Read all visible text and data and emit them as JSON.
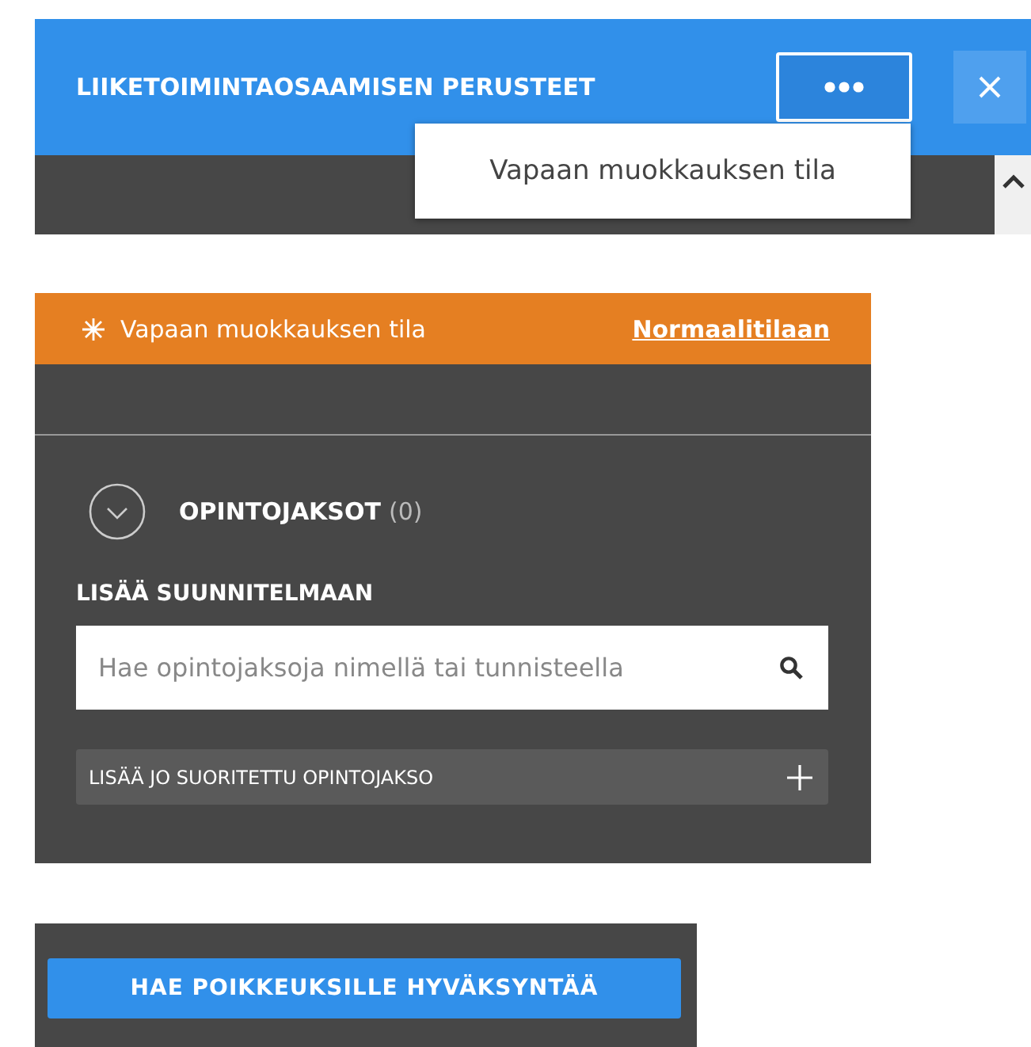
{
  "header": {
    "title": "LIIKETOIMINTAOSAAMISEN PERUSTEET",
    "menu": {
      "items": [
        "Vapaan muokkauksen tila"
      ]
    }
  },
  "mode_banner": {
    "label": "Vapaan muokkauksen tila",
    "link": "Normaalitilaan"
  },
  "section": {
    "title": "OPINTOJAKSOT",
    "count": "(0)"
  },
  "add_label": "LISÄÄ SUUNNITELMAAN",
  "search": {
    "placeholder": "Hae opintojaksoja nimellä tai tunnisteella"
  },
  "add_completed": "LISÄÄ JO SUORITETTU OPINTOJAKSO",
  "exception_button": "HAE POIKKEUKSILLE HYVÄKSYNTÄÄ"
}
